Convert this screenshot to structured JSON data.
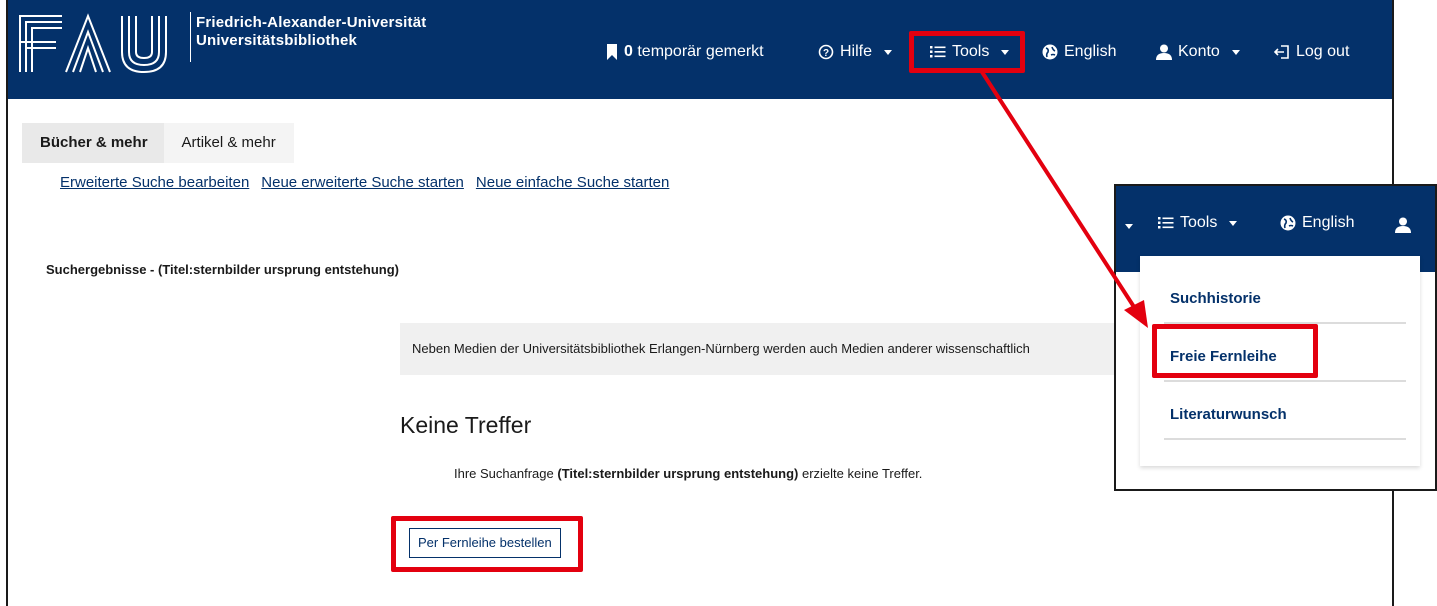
{
  "header": {
    "logo_text": "FAU",
    "university_line1": "Friedrich-Alexander-Universität",
    "university_line2": "Universitätsbibliothek",
    "nav": {
      "bookmarks_count": "0",
      "bookmarks_label": "temporär gemerkt",
      "help": "Hilfe",
      "tools": "Tools",
      "language": "English",
      "account": "Konto",
      "logout": "Log out"
    }
  },
  "tabs": [
    {
      "label": "Bücher & mehr",
      "active": true
    },
    {
      "label": "Artikel & mehr",
      "active": false
    }
  ],
  "search_links": [
    "Erweiterte Suche bearbeiten",
    "Neue erweiterte Suche starten",
    "Neue einfache Suche starten"
  ],
  "results_title": "Suchergebnisse - (Titel:sternbilder ursprung entstehung)",
  "info_text": "Neben Medien der Universitätsbibliothek Erlangen-Nürnberg werden auch Medien anderer wissenschaftlich",
  "no_results": {
    "heading": "Keine Treffer",
    "text_before": "Ihre Suchanfrage",
    "query": "(Titel:sternbilder ursprung entstehung)",
    "text_after": "erzielte keine Treffer."
  },
  "ill_button": "Per Fernleihe bestellen",
  "tools_menu": {
    "tools": "Tools",
    "language": "English",
    "items": [
      "Suchhistorie",
      "Freie Fernleihe",
      "Literaturwunsch"
    ]
  },
  "colors": {
    "header_bg": "#04316a",
    "highlight": "#e3000f",
    "link": "#04316a"
  },
  "icons": [
    "bookmark-icon",
    "help-circle-icon",
    "list-icon",
    "globe-icon",
    "user-icon",
    "logout-icon"
  ]
}
